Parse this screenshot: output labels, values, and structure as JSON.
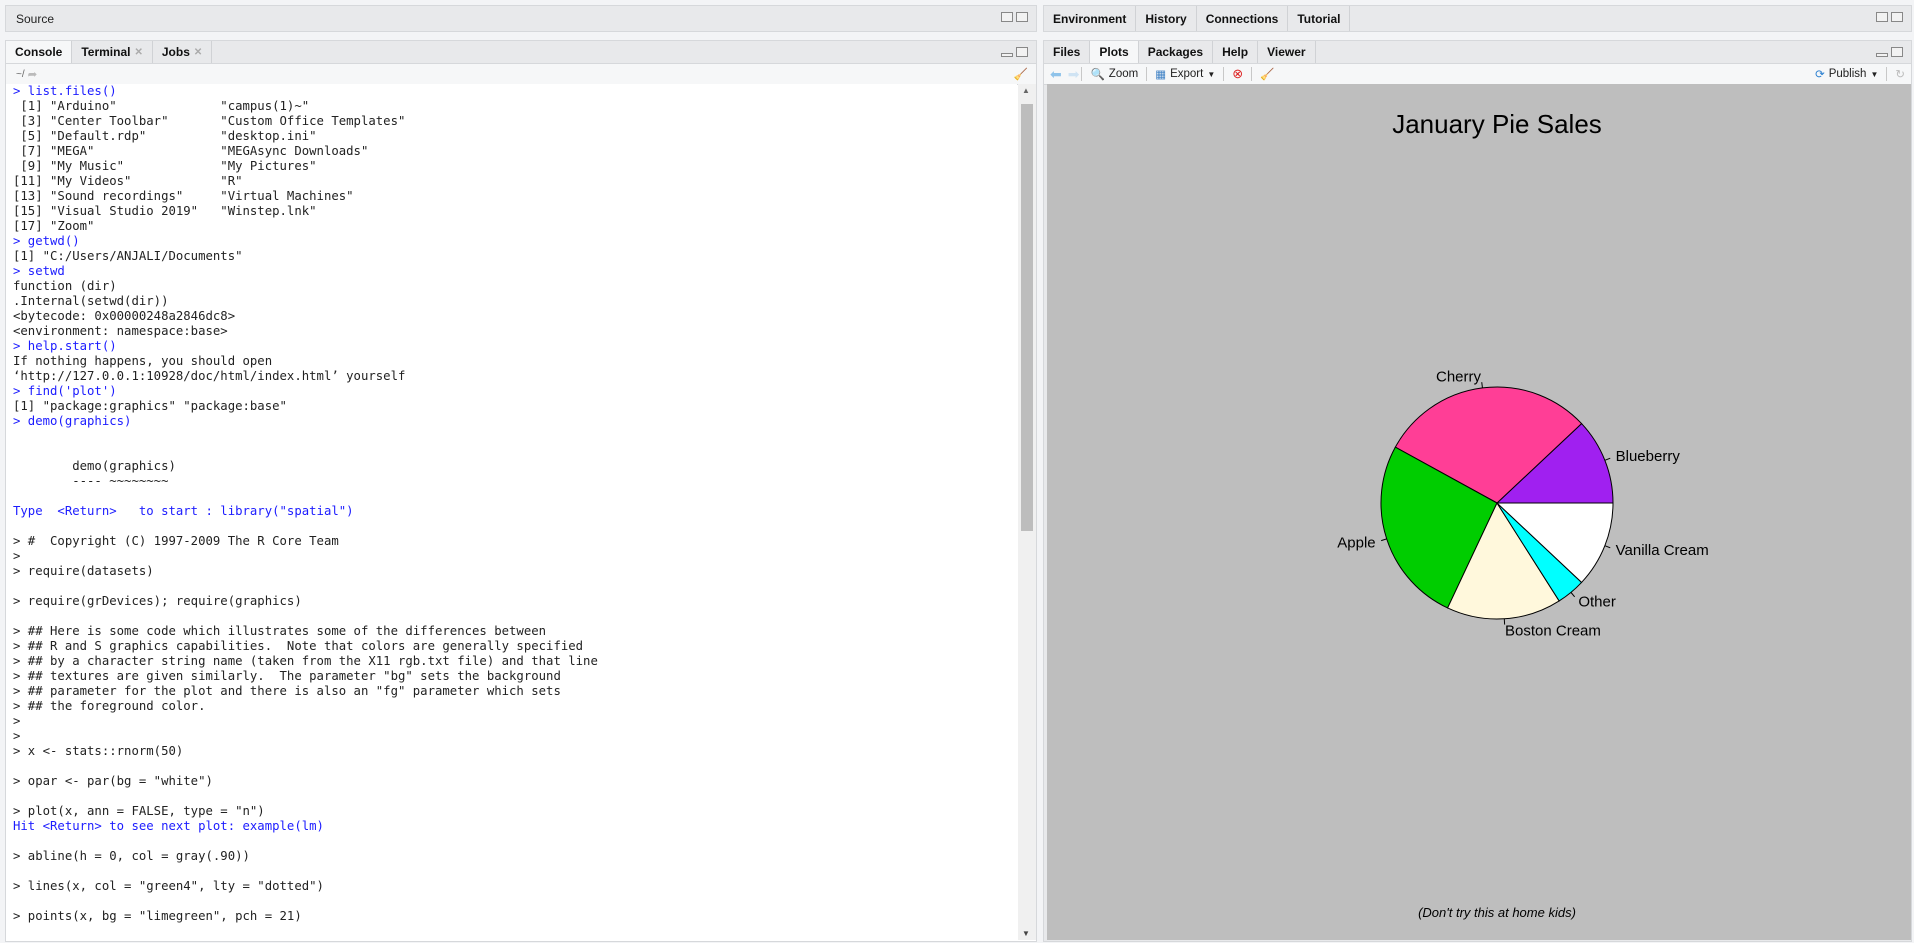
{
  "source_pane": {
    "title": "Source"
  },
  "console_pane": {
    "tabs": [
      {
        "label": "Console"
      },
      {
        "label": "Terminal"
      },
      {
        "label": "Jobs"
      }
    ],
    "path": "~/",
    "lines": [
      {
        "t": "> list.files()",
        "c": 1
      },
      {
        "t": " [1] \"Arduino\"              \"campus(1)~\""
      },
      {
        "t": " [3] \"Center Toolbar\"       \"Custom Office Templates\""
      },
      {
        "t": " [5] \"Default.rdp\"          \"desktop.ini\""
      },
      {
        "t": " [7] \"MEGA\"                 \"MEGAsync Downloads\""
      },
      {
        "t": " [9] \"My Music\"             \"My Pictures\""
      },
      {
        "t": "[11] \"My Videos\"            \"R\""
      },
      {
        "t": "[13] \"Sound recordings\"     \"Virtual Machines\""
      },
      {
        "t": "[15] \"Visual Studio 2019\"   \"Winstep.lnk\""
      },
      {
        "t": "[17] \"Zoom\""
      },
      {
        "t": "> getwd()",
        "c": 1
      },
      {
        "t": "[1] \"C:/Users/ANJALI/Documents\""
      },
      {
        "t": "> setwd",
        "c": 1
      },
      {
        "t": "function (dir)"
      },
      {
        "t": ".Internal(setwd(dir))"
      },
      {
        "t": "<bytecode: 0x00000248a2846dc8>"
      },
      {
        "t": "<environment: namespace:base>"
      },
      {
        "t": "> help.start()",
        "c": 1
      },
      {
        "t": "If nothing happens, you should open"
      },
      {
        "t": "‘http://127.0.0.1:10928/doc/html/index.html’ yourself"
      },
      {
        "t": "> find('plot')",
        "c": 1
      },
      {
        "t": "[1] \"package:graphics\" \"package:base\""
      },
      {
        "t": "> demo(graphics)",
        "c": 1
      },
      {
        "t": ""
      },
      {
        "t": ""
      },
      {
        "t": "        demo(graphics)"
      },
      {
        "t": "        ---- ~~~~~~~~"
      },
      {
        "t": ""
      },
      {
        "t": "Type  <Return>   to start : library(\"spatial\")",
        "c": 1
      },
      {
        "t": ""
      },
      {
        "t": "> #  Copyright (C) 1997-2009 The R Core Team"
      },
      {
        "t": ">"
      },
      {
        "t": "> require(datasets)"
      },
      {
        "t": ""
      },
      {
        "t": "> require(grDevices); require(graphics)"
      },
      {
        "t": ""
      },
      {
        "t": "> ## Here is some code which illustrates some of the differences between"
      },
      {
        "t": "> ## R and S graphics capabilities.  Note that colors are generally specified"
      },
      {
        "t": "> ## by a character string name (taken from the X11 rgb.txt file) and that line"
      },
      {
        "t": "> ## textures are given similarly.  The parameter \"bg\" sets the background"
      },
      {
        "t": "> ## parameter for the plot and there is also an \"fg\" parameter which sets"
      },
      {
        "t": "> ## the foreground color."
      },
      {
        "t": ">"
      },
      {
        "t": ">"
      },
      {
        "t": "> x <- stats::rnorm(50)"
      },
      {
        "t": ""
      },
      {
        "t": "> opar <- par(bg = \"white\")"
      },
      {
        "t": ""
      },
      {
        "t": "> plot(x, ann = FALSE, type = \"n\")"
      },
      {
        "t": "Hit <Return> to see next plot: example(lm)",
        "c": 1
      },
      {
        "t": ""
      },
      {
        "t": "> abline(h = 0, col = gray(.90))"
      },
      {
        "t": ""
      },
      {
        "t": "> lines(x, col = \"green4\", lty = \"dotted\")"
      },
      {
        "t": ""
      },
      {
        "t": "> points(x, bg = \"limegreen\", pch = 21)"
      }
    ]
  },
  "env_pane": {
    "tabs": [
      {
        "label": "Environment"
      },
      {
        "label": "History"
      },
      {
        "label": "Connections"
      },
      {
        "label": "Tutorial"
      }
    ]
  },
  "files_pane": {
    "tabs": [
      {
        "label": "Files"
      },
      {
        "label": "Plots"
      },
      {
        "label": "Packages"
      },
      {
        "label": "Help"
      },
      {
        "label": "Viewer"
      }
    ],
    "toolbar": {
      "zoom": "Zoom",
      "export": "Export",
      "publish": "Publish"
    }
  },
  "chart_data": {
    "type": "pie",
    "title": "January Pie Sales",
    "footnote": "(Don't try this at home kids)",
    "categories": [
      "Blueberry",
      "Cherry",
      "Apple",
      "Boston Cream",
      "Other",
      "Vanilla Cream"
    ],
    "values": [
      0.12,
      0.3,
      0.26,
      0.16,
      0.04,
      0.12
    ],
    "colors": [
      "#a020f0",
      "#ff3e96",
      "#00cd00",
      "#fff8dc",
      "#00ffff",
      "#ffffff"
    ],
    "direction": "counterclockwise",
    "start_angle_deg": 0
  }
}
